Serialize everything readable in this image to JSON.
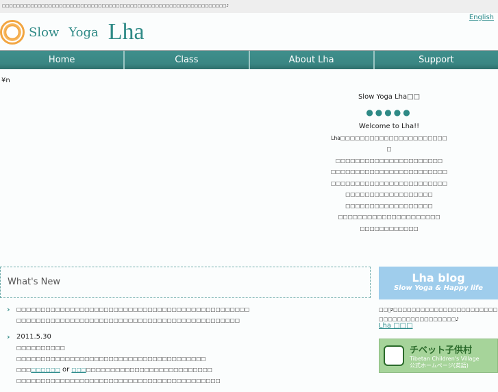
{
  "topbar": {
    "text": "□□□□□□□□□□□□□□□□□□□□□□□□□□□□□□□□□□□□□□□□□□□□□□□□□□□□□□□□□□□□□□□♪"
  },
  "header": {
    "english": "English",
    "logo1": "Slow",
    "logo2": "Yoga",
    "logo3": "Lha"
  },
  "nav": [
    "Home",
    "Class",
    "About Lha",
    "Support"
  ],
  "yen": "¥n",
  "welcome": {
    "title": "Slow Yoga Lha□□",
    "dots": "●●●●●",
    "greeting": "Welcome to Lha!!",
    "lines": [
      "Lha□□□□□□□□□□□□□□□□□□□□□□□",
      "□□□□□□□□□□□□□□□□□□□□□□",
      "□□□□□□□□□□□□□□□□□□□□□□□□",
      "□□□□□□□□□□□□□□□□□□□□□□□□",
      "□□□□□□□□□□□□□□□□□□",
      "□□□□□□□□□□□□□□□□□□",
      "□□□□□□□□□□□□□□□□□□□□□",
      "□□□□□□□□□□□□"
    ]
  },
  "news": {
    "title": "What's New",
    "item1": [
      "□□□□□□□□□□□□□□□□□□□□□□□□□□□□□□□□□□□□□□□□□□□□□□□□",
      "□□□□□□□□□□□□□□□□□□□□□□□□□□□□□□□□□□□□□□□□□□□□□□"
    ],
    "item2": {
      "date": "2011.5.30",
      "line1": "□□□□□□□□□□",
      "line2": "□□□□□□□□□□□□□□□□□□□□□□□□□□□□□□□□□□□□□□□",
      "pre": "□□□",
      "link1": "□□□□□□",
      "or": " or ",
      "link2": "□□□",
      "post": "□□□□□□□□□□□□□□□□□□□□□□□□□□",
      "line4": "□□□□□□□□□□□□□□□□□□□□□□□□□□□□□□□□□□□□□□□□□□"
    }
  },
  "sidebar": {
    "blog_title": "Lha blog",
    "blog_sub": "Slow Yoga & Happy life",
    "blog_text": "□□ﾞz□□□□□□□□□□□□□□□□□□□□□□□□□□□□□□□□□□□□□□□□♪",
    "blog_link": "Lha □□□",
    "tcv1": "チベット子供村",
    "tcv2": "Tibetan Children's Village",
    "tcv3": "公式ホームページ(英語)"
  }
}
